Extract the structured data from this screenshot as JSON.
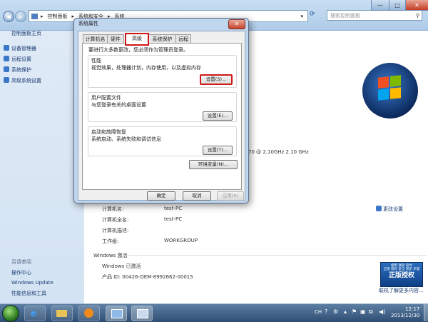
{
  "address": {
    "crumbs": [
      "控制面板",
      "系统和安全",
      "系统"
    ],
    "search_placeholder": "搜索控制面板"
  },
  "window_controls": {
    "minimize": "—",
    "maximize": "□",
    "close": "✕"
  },
  "left_pane": {
    "home": "控制面板主页",
    "links": [
      {
        "label": "设备管理器",
        "icon": "shield-icon"
      },
      {
        "label": "远程设置",
        "icon": "shield-icon"
      },
      {
        "label": "系统保护",
        "icon": "shield-icon"
      },
      {
        "label": "高级系统设置",
        "icon": "shield-icon"
      }
    ],
    "see_also_title": "另请参阅",
    "see_also": [
      "操作中心",
      "Windows Update",
      "性能信息和工具"
    ]
  },
  "main": {
    "cpu_fragment": "70  @ 2.10GHz   2.10 GHz",
    "computer": {
      "rows": [
        {
          "label": "计算机名:",
          "value": "test-PC"
        },
        {
          "label": "计算机全名:",
          "value": "test-PC"
        },
        {
          "label": "计算机描述:",
          "value": ""
        },
        {
          "label": "工作组:",
          "value": "WORKGROUP"
        }
      ],
      "change_settings": "更改设置"
    },
    "activation": {
      "title": "Windows 激活",
      "status": "Windows 已激活",
      "product_id": "产品 ID: 00426-OEM-8992662-00015"
    },
    "genuine": {
      "badge_small": "使用 微软 软件\n正版 授权 安全 稳定 声誉",
      "badge_big": "正版授权",
      "more_link": "联机了解更多内容..."
    }
  },
  "dialog": {
    "title": "系统属性",
    "close": "✕",
    "tabs": [
      "计算机名",
      "硬件",
      "高级",
      "系统保护",
      "远程"
    ],
    "active_tab": 2,
    "admin_note": "要进行大多数更改，您必须作为管理员登录。",
    "groups": [
      {
        "title": "性能",
        "desc": "视觉效果，处理器计划，内存使用，以及虚拟内存",
        "button": "设置(S)..."
      },
      {
        "title": "用户配置文件",
        "desc": "与您登录有关的桌面设置",
        "button": "设置(E)..."
      },
      {
        "title": "启动和故障恢复",
        "desc": "系统启动、系统失败和调试信息",
        "button": "设置(T)..."
      }
    ],
    "env_button": "环境变量(N)...",
    "ok": "确定",
    "cancel": "取消",
    "apply": "应用(A)"
  },
  "taskbar": {
    "lang": "CH",
    "time": "12:17",
    "date": "2013/12/30"
  },
  "colors": {
    "highlight": "#d01818",
    "link": "#1a3a72",
    "taskbar": "#2e4d73"
  }
}
